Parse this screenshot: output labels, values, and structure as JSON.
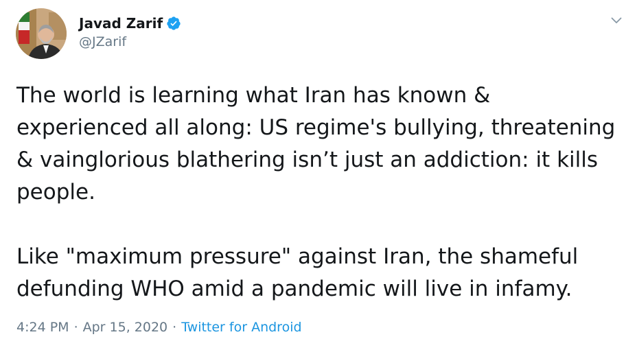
{
  "author": {
    "display_name": "Javad Zarif",
    "handle": "@JZarif",
    "verified": true,
    "avatar_icon": "profile-photo"
  },
  "tweet": {
    "paragraph_1": "The world is learning what Iran has known & experienced all along: US regime's bullying, threatening & vainglorious blathering isn’t just an addiction: it kills people.",
    "paragraph_2": "Like \"maximum pressure\" against Iran, the shameful defunding WHO amid a pandemic will live in infamy."
  },
  "meta": {
    "time": "4:24 PM",
    "separator": "·",
    "date": "Apr 15, 2020",
    "source": "Twitter for Android"
  },
  "colors": {
    "text": "#14171a",
    "muted": "#657786",
    "link": "#1b95e0",
    "verified": "#1da1f2"
  }
}
